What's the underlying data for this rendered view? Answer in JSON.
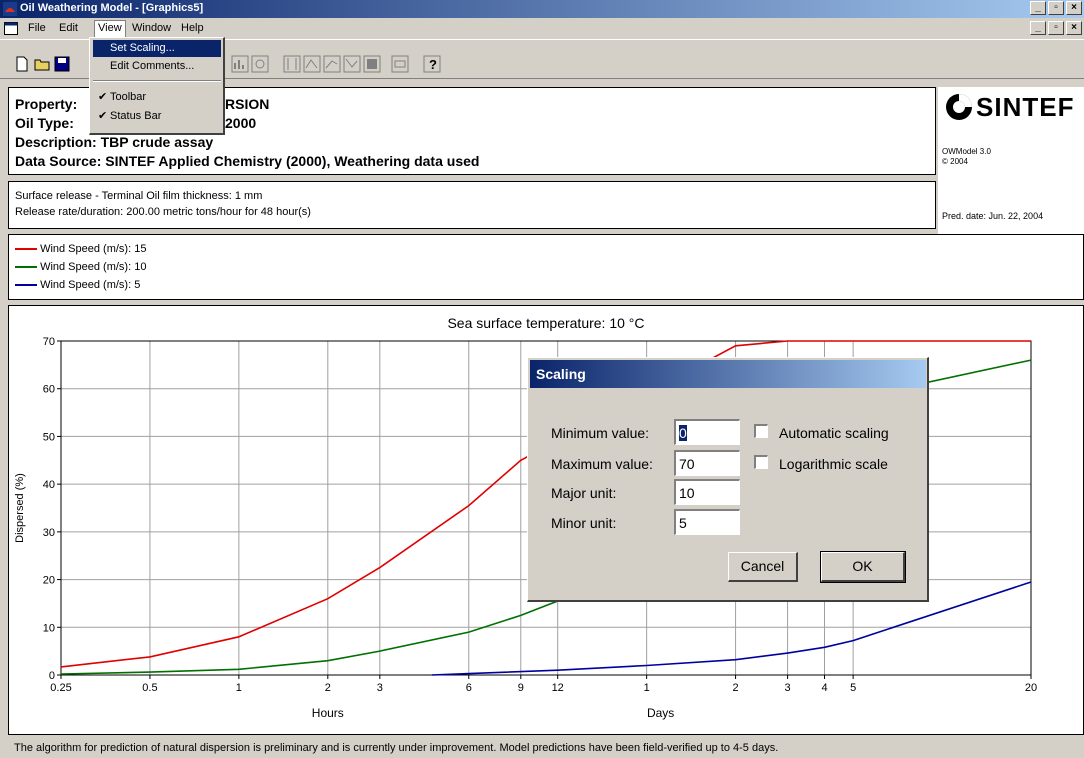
{
  "window": {
    "title": "Oil Weathering Model - [Graphics5]"
  },
  "menu": {
    "file": "File",
    "edit": "Edit",
    "view": "View",
    "window": "Window",
    "help": "Help"
  },
  "view_menu": {
    "set_scaling": "Set Scaling...",
    "edit_comments": "Edit Comments...",
    "toolbar": "Toolbar",
    "status_bar": "Status Bar"
  },
  "header": {
    "property_label": "Property:",
    "property_value": "RSION",
    "oil_type_label": "Oil Type:",
    "oil_type_value": "2000",
    "description": "Description: TBP crude assay",
    "data_source": "Data Source: SINTEF Applied Chemistry (2000), Weathering data used",
    "logo": "SINTEF",
    "model_version": "OWModel 3.0",
    "copyright": "© 2004",
    "pred_date": "Pred. date: Jun. 22, 2004"
  },
  "scenario": {
    "line1": "Surface release - Terminal Oil film thickness: 1 mm",
    "line2": "Release rate/duration: 200.00 metric tons/hour for 48 hour(s)"
  },
  "legend": [
    {
      "label": "Wind Speed (m/s): 15",
      "color": "#e00000"
    },
    {
      "label": "Wind Speed (m/s): 10",
      "color": "#007000"
    },
    {
      "label": "Wind Speed (m/s): 5",
      "color": "#0000a0"
    }
  ],
  "footer_note": "The algorithm for prediction of natural dispersion is preliminary and is currently under improvement. Model predictions have been field-verified up to 4-5 days.",
  "dialog": {
    "title": "Scaling",
    "min_label": "Minimum value:",
    "min_value": "0",
    "max_label": "Maximum value:",
    "max_value": "70",
    "major_label": "Major unit:",
    "major_value": "10",
    "minor_label": "Minor unit:",
    "minor_value": "5",
    "auto_label": "Automatic scaling",
    "log_label": "Logarithmic scale",
    "cancel": "Cancel",
    "ok": "OK"
  },
  "chart_data": {
    "type": "line",
    "title": "Sea surface temperature: 10 °C",
    "ylabel": "Dispersed (%)",
    "xlabel_hours": "Hours",
    "xlabel_days": "Days",
    "ylim": [
      0,
      70
    ],
    "yticks": [
      0,
      10,
      20,
      30,
      40,
      50,
      60,
      70
    ],
    "x_scale": "log (time)",
    "xticks_hours": [
      "0.25",
      "0.5",
      "1",
      "2",
      "3",
      "6",
      "9",
      "12"
    ],
    "xticks_days": [
      "1",
      "2",
      "3",
      "4",
      "5",
      "20"
    ],
    "xticks_hours_values": [
      0.25,
      0.5,
      1,
      2,
      3,
      6,
      9,
      12
    ],
    "xticks_days_values_h": [
      24,
      48,
      72,
      96,
      120,
      480
    ],
    "grid": true,
    "series": [
      {
        "name": "Wind Speed (m/s): 15",
        "color": "#e00000",
        "x_hours": [
          0.25,
          0.5,
          1,
          2,
          3,
          6,
          9,
          48,
          72,
          480
        ],
        "y": [
          1.7,
          3.8,
          8,
          16,
          22.5,
          35.5,
          45,
          69,
          70,
          70
        ]
      },
      {
        "name": "Wind Speed (m/s): 10",
        "color": "#007000",
        "x_hours": [
          0.25,
          0.5,
          1,
          2,
          3,
          6,
          9,
          12,
          120,
          480
        ],
        "y": [
          0.2,
          0.6,
          1.2,
          3,
          5,
          9,
          12.5,
          15.5,
          58,
          66
        ]
      },
      {
        "name": "Wind Speed (m/s): 5",
        "color": "#0000a0",
        "x_hours": [
          4.5,
          6,
          12,
          24,
          48,
          72,
          96,
          120,
          480
        ],
        "y": [
          0,
          0.3,
          1,
          2,
          3.2,
          4.6,
          5.8,
          7.2,
          19.5
        ]
      }
    ]
  }
}
